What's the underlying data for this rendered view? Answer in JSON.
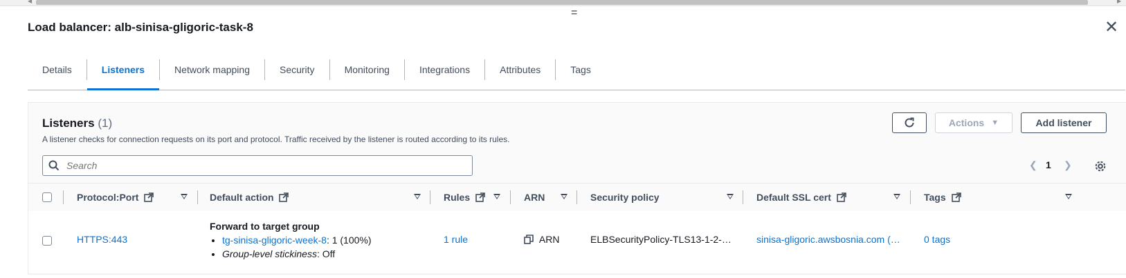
{
  "header": {
    "title": "Load balancer: alb-sinisa-gligoric-task-8",
    "drag_handle": "="
  },
  "tabs": [
    {
      "label": "Details",
      "active": false
    },
    {
      "label": "Listeners",
      "active": true
    },
    {
      "label": "Network mapping",
      "active": false
    },
    {
      "label": "Security",
      "active": false
    },
    {
      "label": "Monitoring",
      "active": false
    },
    {
      "label": "Integrations",
      "active": false
    },
    {
      "label": "Attributes",
      "active": false
    },
    {
      "label": "Tags",
      "active": false
    }
  ],
  "listeners": {
    "title": "Listeners",
    "count": "(1)",
    "description": "A listener checks for connection requests on its port and protocol. Traffic received by the listener is routed according to its rules.",
    "actions_label": "Actions",
    "add_label": "Add listener",
    "search_placeholder": "Search",
    "page": "1"
  },
  "table": {
    "columns": {
      "protocol_port": "Protocol:Port",
      "default_action": "Default action",
      "rules": "Rules",
      "arn": "ARN",
      "security_policy": "Security policy",
      "default_ssl_cert": "Default SSL cert",
      "tags": "Tags"
    },
    "rows": [
      {
        "protocol_port": "HTTPS:443",
        "default_action_title": "Forward to target group",
        "target_group": "tg-sinisa-gligoric-week-8",
        "target_weight": ": 1 (100%)",
        "stickiness_label": "Group-level stickiness",
        "stickiness_value": ": Off",
        "rules": "1 rule",
        "arn": "ARN",
        "security_policy": "ELBSecurityPolicy-TLS13-1-2-…",
        "ssl_cert": "sinisa-gligoric.awsbosnia.com (…",
        "tags": "0 tags"
      }
    ]
  },
  "colors": {
    "link": "#0972d3",
    "text": "#16191f",
    "muted": "#414d5c",
    "disabled": "#9ba7b6"
  }
}
